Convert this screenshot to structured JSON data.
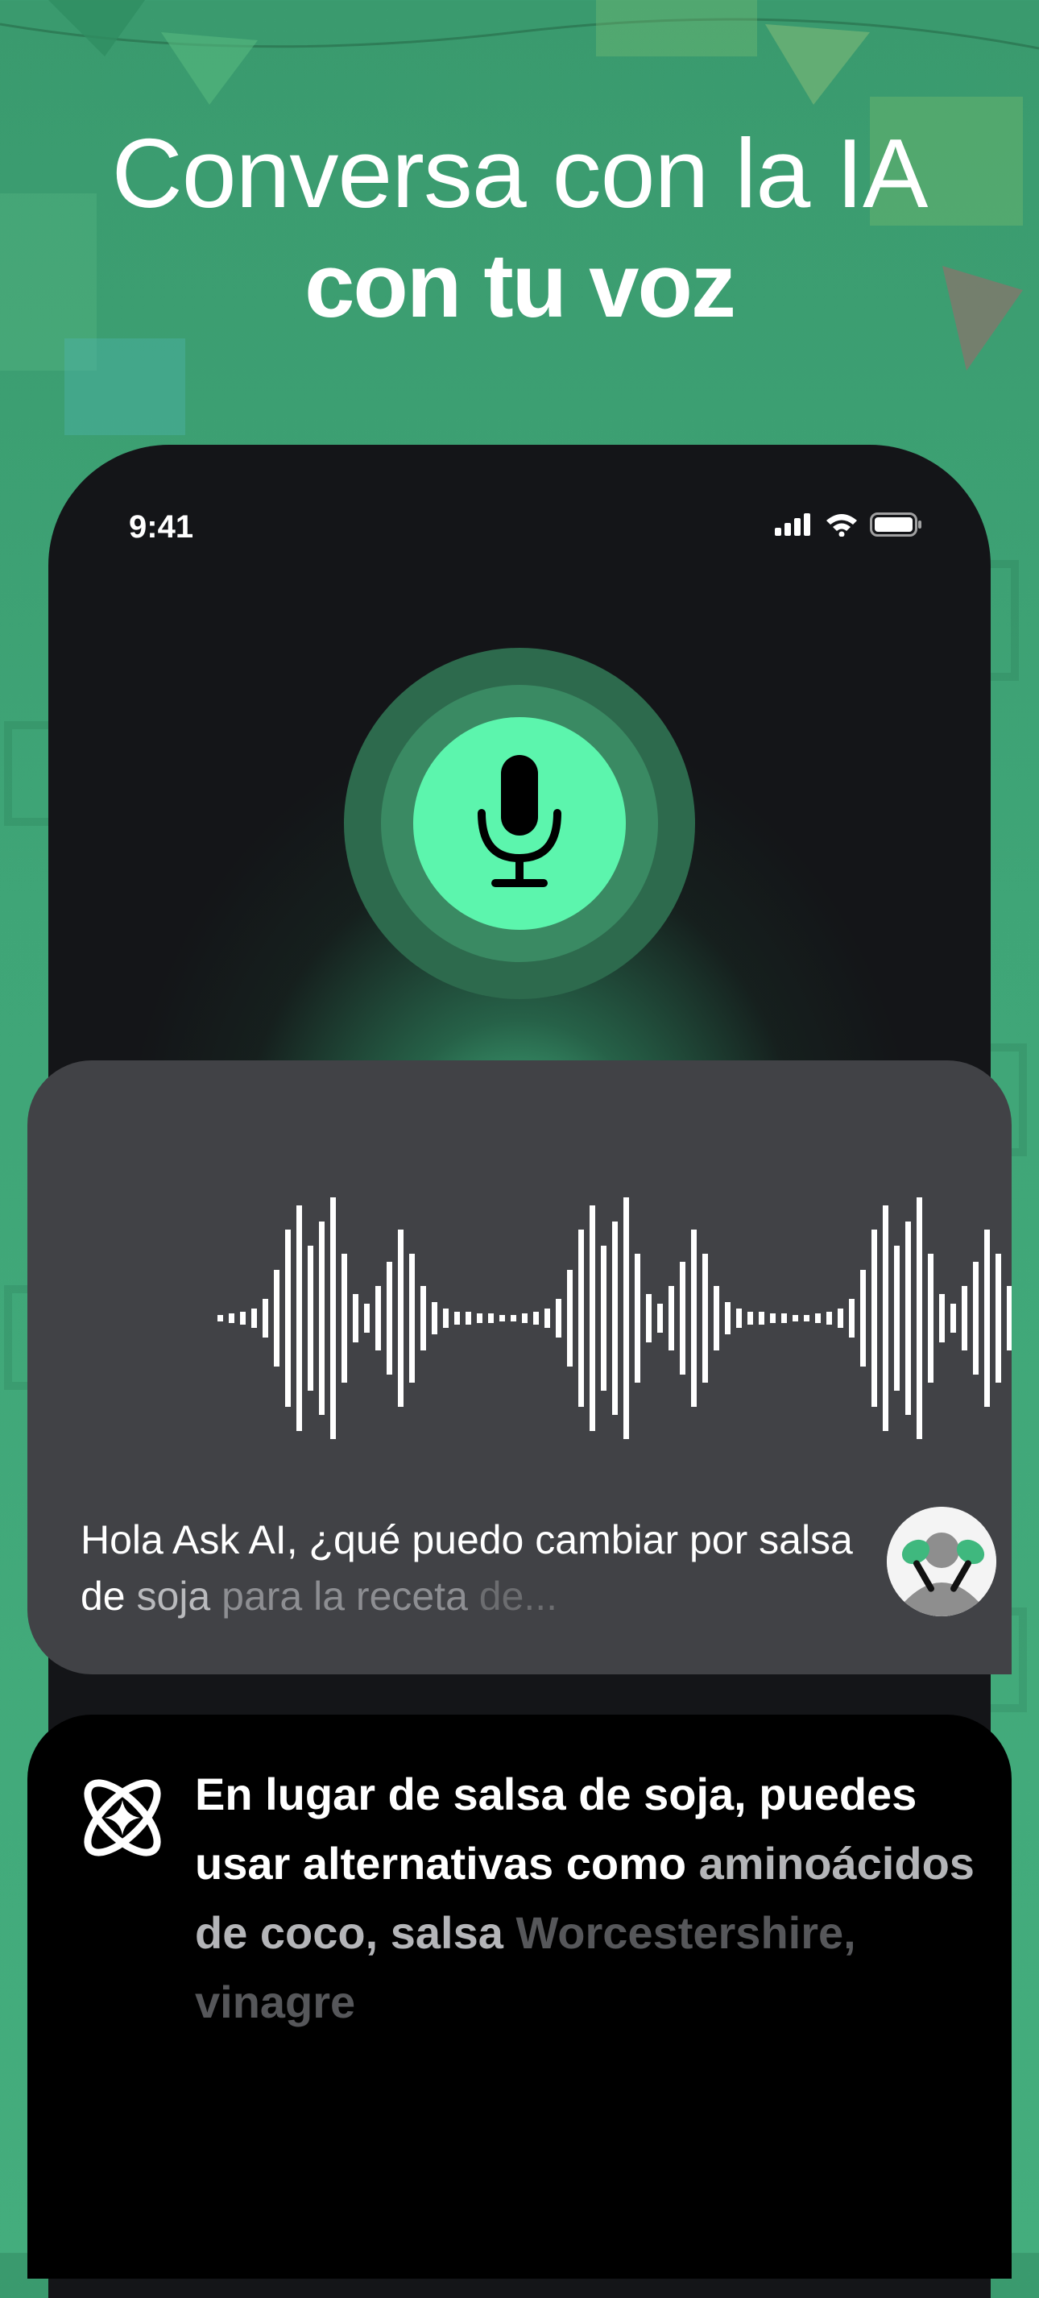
{
  "headline": {
    "line1": "Conversa con la IA",
    "line2": "con tu voz"
  },
  "status_bar": {
    "time": "9:41",
    "icons": [
      "cellular-signal-icon",
      "wifi-icon",
      "battery-icon"
    ]
  },
  "mic": {
    "icon": "microphone-icon",
    "accent_color": "#5cf5ad"
  },
  "voice_card": {
    "transcript_part1": "Hola Ask AI, ¿qué puedo cambiar por salsa de ",
    "transcript_part2": "soja ",
    "transcript_part3": "para la receta ",
    "transcript_part4": "de...",
    "avatar": "user-avatar-maracas"
  },
  "answer_card": {
    "icon": "ask-ai-logo-icon",
    "text_part1": "En lugar de salsa de soja, puedes usar alternativas como ",
    "text_part2": "aminoácidos de coco, salsa ",
    "text_part3": "Worcestershire, vinagre"
  },
  "colors": {
    "background": "#3fa577",
    "phone": "#141518",
    "card": "#414246"
  }
}
